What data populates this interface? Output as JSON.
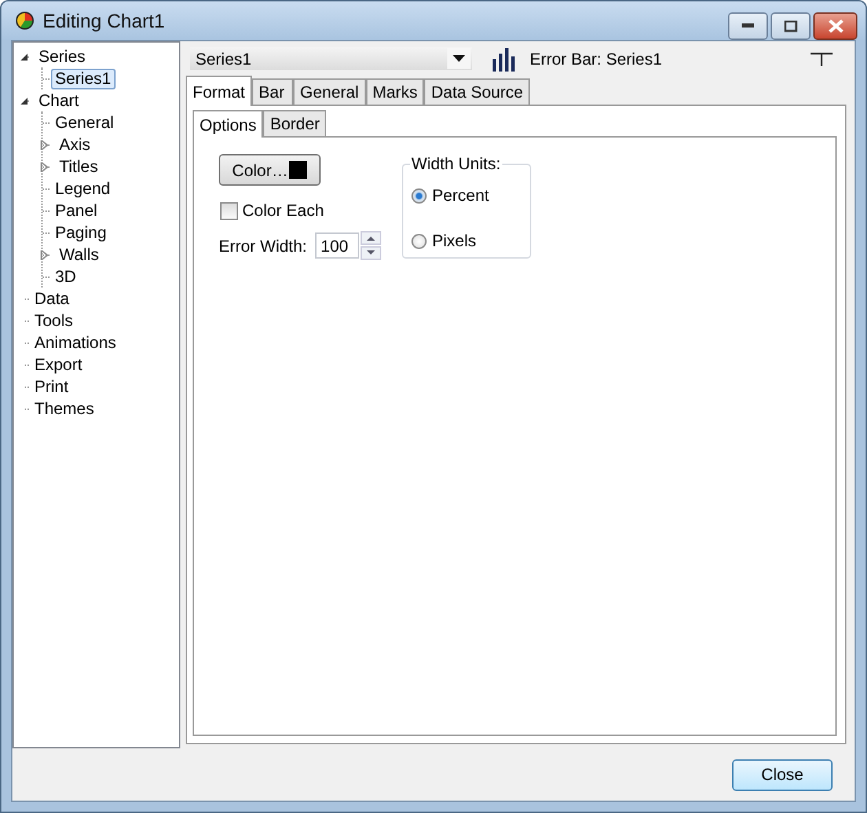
{
  "window": {
    "title": "Editing Chart1"
  },
  "tree": [
    {
      "label": "Series",
      "expanded": true,
      "selected": false,
      "children": [
        {
          "label": "Series1",
          "selected": true
        }
      ]
    },
    {
      "label": "Chart",
      "expanded": true,
      "selected": false,
      "children": [
        {
          "label": "General",
          "selected": false
        },
        {
          "label": "Axis",
          "expanded": false,
          "selected": false
        },
        {
          "label": "Titles",
          "expanded": false,
          "selected": false
        },
        {
          "label": "Legend",
          "selected": false
        },
        {
          "label": "Panel",
          "selected": false
        },
        {
          "label": "Paging",
          "selected": false
        },
        {
          "label": "Walls",
          "expanded": false,
          "selected": false
        },
        {
          "label": "3D",
          "selected": false
        }
      ]
    },
    {
      "label": "Data",
      "selected": false
    },
    {
      "label": "Tools",
      "selected": false
    },
    {
      "label": "Animations",
      "selected": false
    },
    {
      "label": "Export",
      "selected": false
    },
    {
      "label": "Print",
      "selected": false
    },
    {
      "label": "Themes",
      "selected": false
    }
  ],
  "series_select": {
    "value": "Series1"
  },
  "series_label": "Error Bar: Series1",
  "tabs": [
    {
      "label": "Format",
      "selected": true
    },
    {
      "label": "Bar",
      "selected": false
    },
    {
      "label": "General",
      "selected": false
    },
    {
      "label": "Marks",
      "selected": false
    },
    {
      "label": "Data Source",
      "selected": false
    }
  ],
  "subtabs": [
    {
      "label": "Options",
      "selected": true
    },
    {
      "label": "Border",
      "selected": false
    }
  ],
  "color_button": {
    "label": "Color…",
    "color": "#000000"
  },
  "color_each": {
    "label": "Color Each",
    "checked": false
  },
  "error_width": {
    "label": "Error Width:",
    "value": "100"
  },
  "width_units": {
    "title": "Width Units:",
    "options": [
      {
        "label": "Percent",
        "selected": true
      },
      {
        "label": "Pixels",
        "selected": false
      }
    ]
  },
  "buttons": [
    "Close"
  ]
}
